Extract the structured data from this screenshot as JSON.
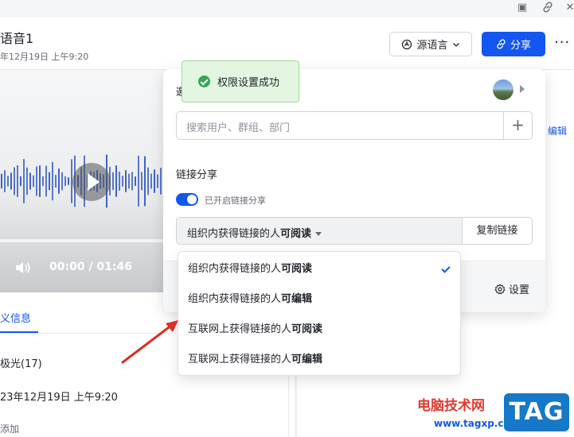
{
  "header": {
    "title": "语音1",
    "time": "年12月19日 上午9:20",
    "lang_button": "源语言",
    "share_button": "分享",
    "more": "···"
  },
  "player": {
    "time": "00:00 / 01:46"
  },
  "info": {
    "tab": "义信息",
    "people": "极光(17)",
    "date": "23年12月19日 上午9:20",
    "add": "添加"
  },
  "right": {
    "edit_link": "编辑"
  },
  "toast": {
    "message": "权限设置成功"
  },
  "share_panel": {
    "header_partial": "邀",
    "search_placeholder": "搜索用户、群组、部门",
    "add_icon": "+",
    "link_section_title": "链接分享",
    "toggle_label": "已开启链接分享",
    "toggle_on": true,
    "permission": {
      "prefix": "组织内获得链接的人",
      "bold": "可阅读"
    },
    "copy_link": "复制链接",
    "settings": "设置"
  },
  "permission_menu": {
    "selected_index": 0,
    "items": [
      {
        "prefix": "组织内获得链接的人",
        "bold": "可阅读"
      },
      {
        "prefix": "组织内获得链接的人",
        "bold": "可编辑"
      },
      {
        "prefix": "互联网上获得链接的人",
        "bold": "可阅读"
      },
      {
        "prefix": "互联网上获得链接的人",
        "bold": "可编辑"
      }
    ]
  },
  "watermark": {
    "site_name": "电脑技术网",
    "url": "www.tagxp.com",
    "tag": "TAG"
  },
  "colors": {
    "primary": "#1456f0",
    "toast_bg": "#e4f6e1",
    "toast_border": "#9fd89a",
    "success": "#34a853",
    "arrow": "#d93025"
  }
}
